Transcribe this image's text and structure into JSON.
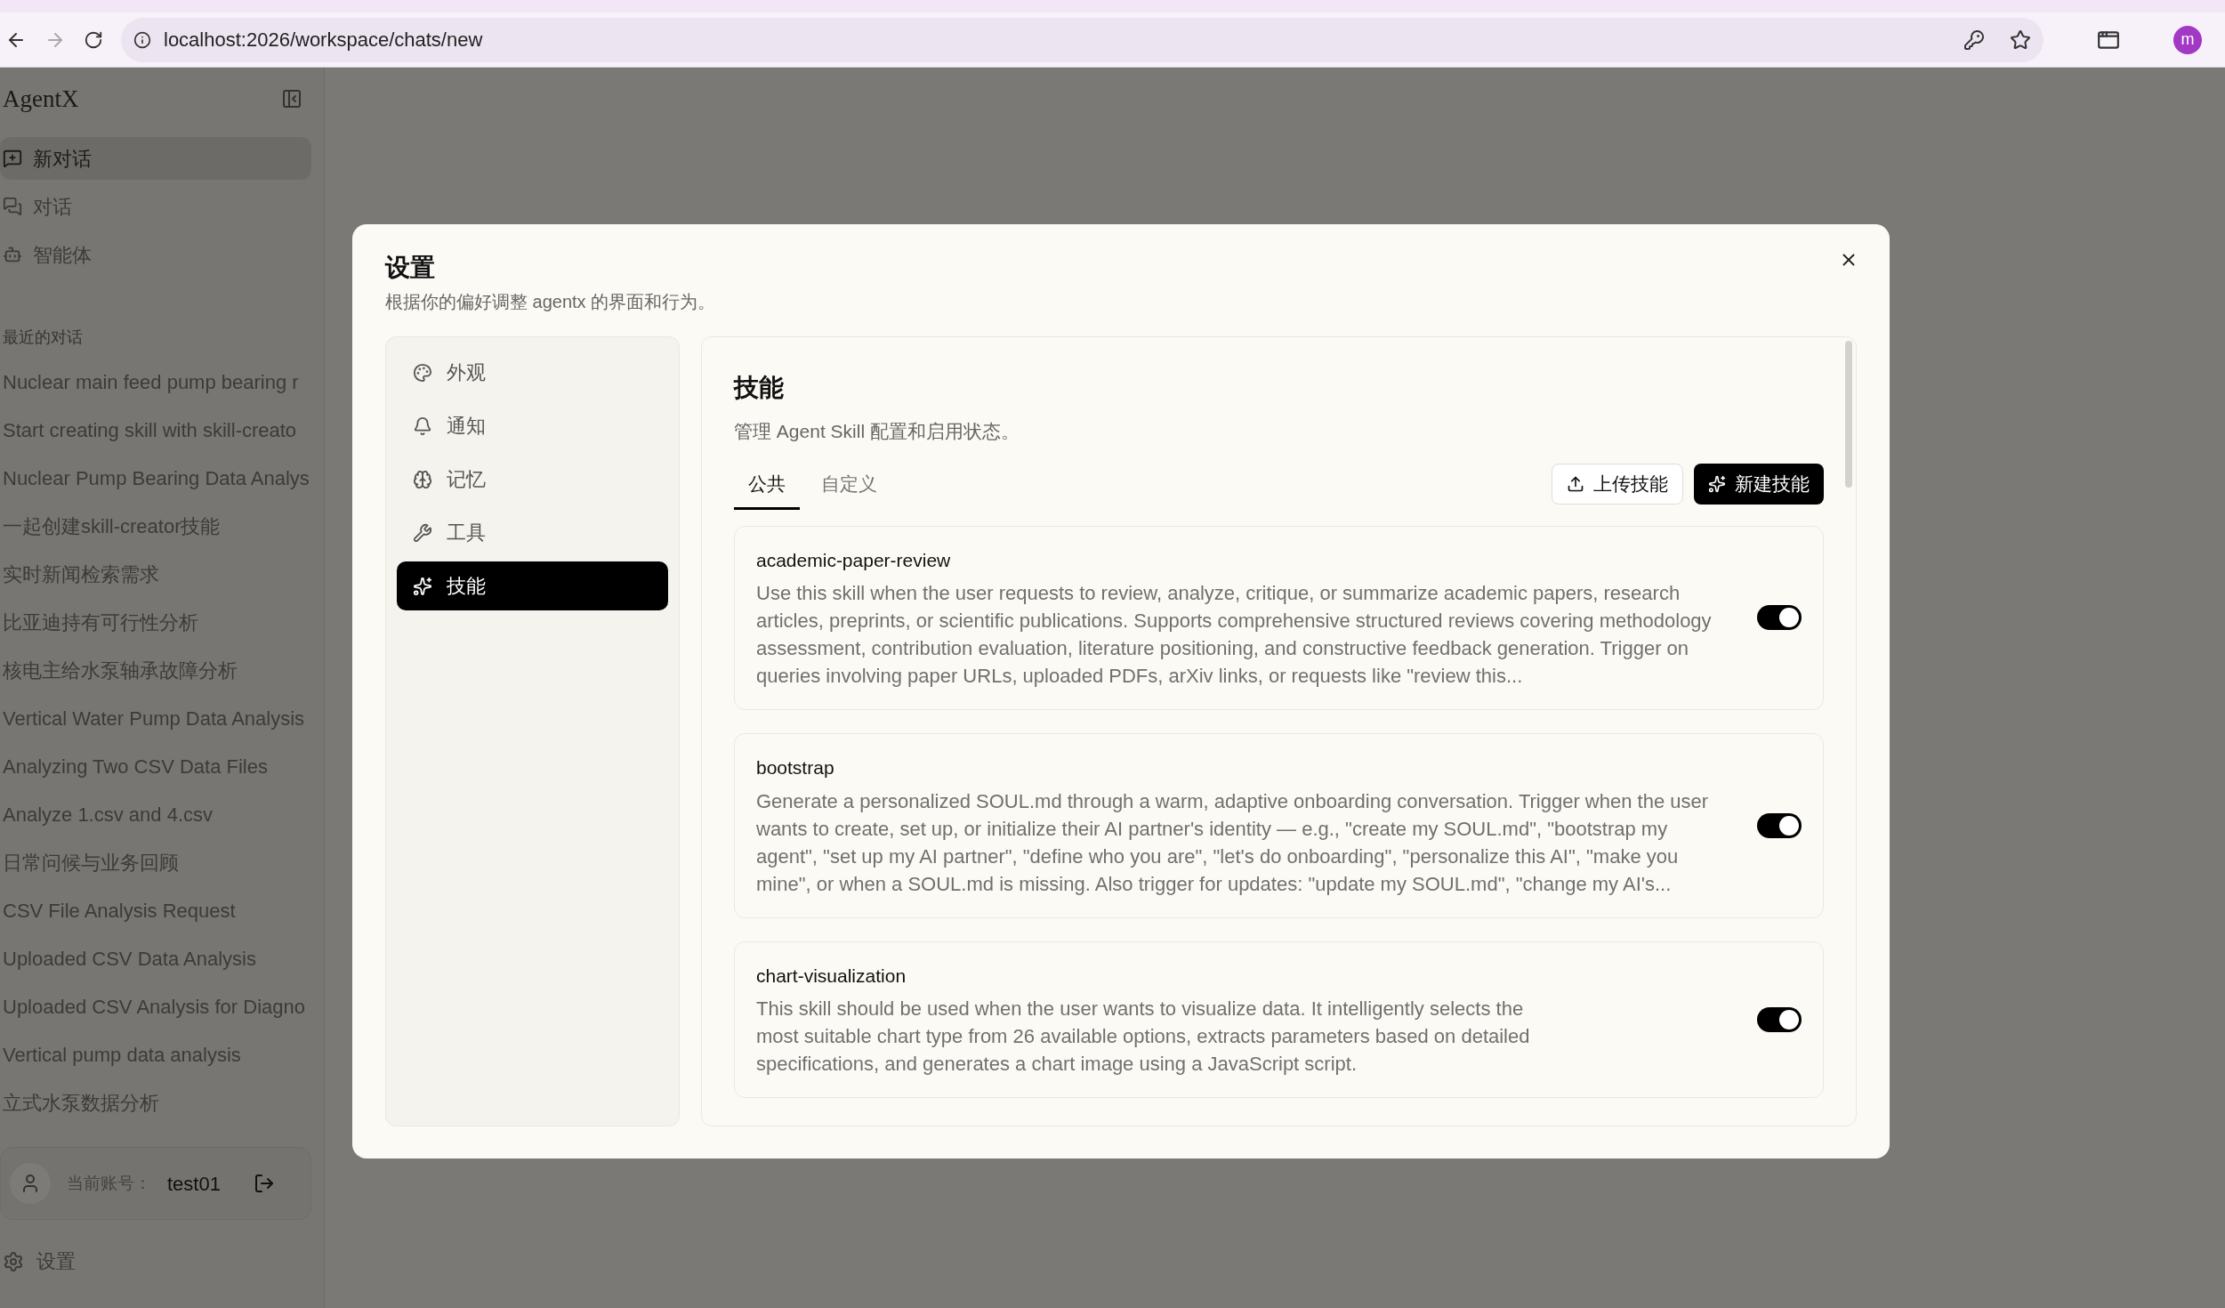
{
  "browser": {
    "url": "localhost:2026/workspace/chats/new",
    "profile": "m"
  },
  "sidebar": {
    "brand": "AgentX",
    "nav": [
      {
        "label": "新对话",
        "selected": true
      },
      {
        "label": "对话",
        "selected": false
      },
      {
        "label": "智能体",
        "selected": false
      }
    ],
    "recent_heading": "最近的对话",
    "recent": [
      "Nuclear main feed pump bearing r",
      "Start creating skill with skill-creato",
      "Nuclear Pump Bearing Data Analys",
      "一起创建skill-creator技能",
      "实时新闻检索需求",
      "比亚迪持有可行性分析",
      "核电主给水泵轴承故障分析",
      "Vertical Water Pump Data Analysis",
      "Analyzing Two CSV Data Files",
      "Analyze 1.csv and 4.csv",
      "日常问候与业务回顾",
      "CSV File Analysis Request",
      "Uploaded CSV Data Analysis",
      "Uploaded CSV Analysis for Diagno",
      "Vertical pump data analysis",
      "立式水泵数据分析"
    ],
    "account": {
      "label": "当前账号：",
      "name": "test01"
    },
    "settings": "设置"
  },
  "dialog": {
    "title": "设置",
    "subtitle": "根据你的偏好调整 agentx 的界面和行为。",
    "nav": [
      {
        "label": "外观",
        "selected": false
      },
      {
        "label": "通知",
        "selected": false
      },
      {
        "label": "记忆",
        "selected": false
      },
      {
        "label": "工具",
        "selected": false
      },
      {
        "label": "技能",
        "selected": true
      }
    ],
    "section_title": "技能",
    "section_subtitle": "管理 Agent Skill 配置和启用状态。",
    "tabs": [
      {
        "label": "公共",
        "selected": true
      },
      {
        "label": "自定义",
        "selected": false
      }
    ],
    "upload_button": "上传技能",
    "new_button": "新建技能",
    "skills": [
      {
        "name": "academic-paper-review",
        "description": "Use this skill when the user requests to review, analyze, critique, or summarize academic papers, research articles, preprints, or scientific publications. Supports comprehensive structured reviews covering methodology assessment, contribution evaluation, literature positioning, and constructive feedback generation. Trigger on queries involving paper URLs, uploaded PDFs, arXiv links, or requests like \"review this...",
        "enabled": true
      },
      {
        "name": "bootstrap",
        "description": "Generate a personalized SOUL.md through a warm, adaptive onboarding conversation. Trigger when the user wants to create, set up, or initialize their AI partner's identity — e.g., \"create my SOUL.md\", \"bootstrap my agent\", \"set up my AI partner\", \"define who you are\", \"let's do onboarding\", \"personalize this AI\", \"make you mine\", or when a SOUL.md is missing. Also trigger for updates: \"update my SOUL.md\", \"change my AI's...",
        "enabled": true
      },
      {
        "name": "chart-visualization",
        "description": "This skill should be used when the user wants to visualize data. It intelligently selects the most suitable chart type from 26 available options, extracts parameters based on detailed specifications, and generates a chart image using a JavaScript script.",
        "enabled": true
      }
    ]
  }
}
